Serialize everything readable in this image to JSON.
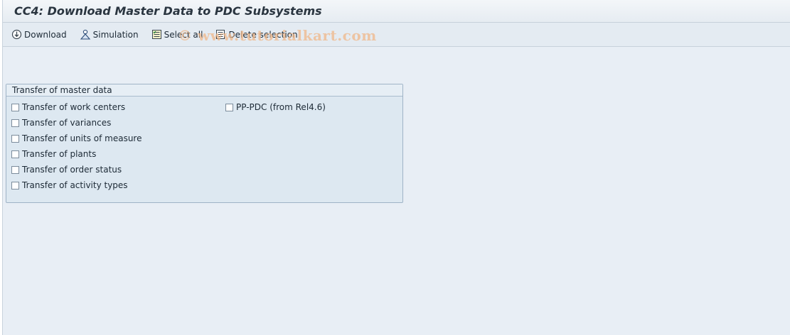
{
  "window": {
    "title": "CC4: Download Master Data to PDC Subsystems"
  },
  "toolbar": {
    "download_label": "Download",
    "simulation_label": "Simulation",
    "select_all_label": "Select all",
    "delete_selection_label": "Delete selection",
    "watermark": "© www.tutorialkart.com"
  },
  "group": {
    "title": "Transfer of master data",
    "left_options": [
      {
        "label": "Transfer of work centers",
        "checked": false
      },
      {
        "label": "Transfer of variances",
        "checked": false
      },
      {
        "label": "Transfer of units of measure",
        "checked": false
      },
      {
        "label": "Transfer of plants",
        "checked": false
      },
      {
        "label": "Transfer of order status",
        "checked": false
      },
      {
        "label": "Transfer of activity types",
        "checked": false
      }
    ],
    "right_options": [
      {
        "label": "PP-PDC (from Rel4.6)",
        "checked": false
      }
    ]
  }
}
